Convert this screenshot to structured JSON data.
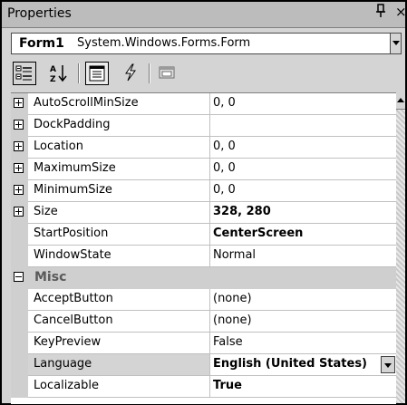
{
  "window": {
    "title": "Properties",
    "pin_glyph": "ᵖ",
    "close_glyph": "×"
  },
  "selector": {
    "object_name": "Form1",
    "object_type": "System.Windows.Forms.Form"
  },
  "toolbar": {
    "buttons": [
      {
        "id": "categorized",
        "icon": "categorized-icon",
        "pressed": true
      },
      {
        "id": "alphabetical",
        "icon": "alphabetical-icon",
        "pressed": false
      },
      {
        "id": "properties",
        "icon": "properties-icon",
        "pressed": true
      },
      {
        "id": "events",
        "icon": "lightning-icon",
        "pressed": false
      },
      {
        "id": "property-pages",
        "icon": "property-pages-icon",
        "pressed": false
      }
    ]
  },
  "grid": {
    "rows": [
      {
        "name": "AutoScrollMinSize",
        "value": "0, 0",
        "expander": "plus"
      },
      {
        "name": "DockPadding",
        "value": "",
        "expander": "plus"
      },
      {
        "name": "Location",
        "value": "0, 0",
        "expander": "plus"
      },
      {
        "name": "MaximumSize",
        "value": "0, 0",
        "expander": "plus"
      },
      {
        "name": "MinimumSize",
        "value": "0, 0",
        "expander": "plus"
      },
      {
        "name": "Size",
        "value": "328, 280",
        "expander": "plus",
        "bold": true
      },
      {
        "name": "StartPosition",
        "value": "CenterScreen",
        "bold": true
      },
      {
        "name": "WindowState",
        "value": "Normal"
      },
      {
        "category": "Misc",
        "expander": "minus"
      },
      {
        "name": "AcceptButton",
        "value": "(none)"
      },
      {
        "name": "CancelButton",
        "value": "(none)"
      },
      {
        "name": "KeyPreview",
        "value": "False"
      },
      {
        "name": "Language",
        "value": "English (United States)",
        "bold": true,
        "selected": true
      },
      {
        "name": "Localizable",
        "value": "True",
        "bold": true
      }
    ]
  }
}
